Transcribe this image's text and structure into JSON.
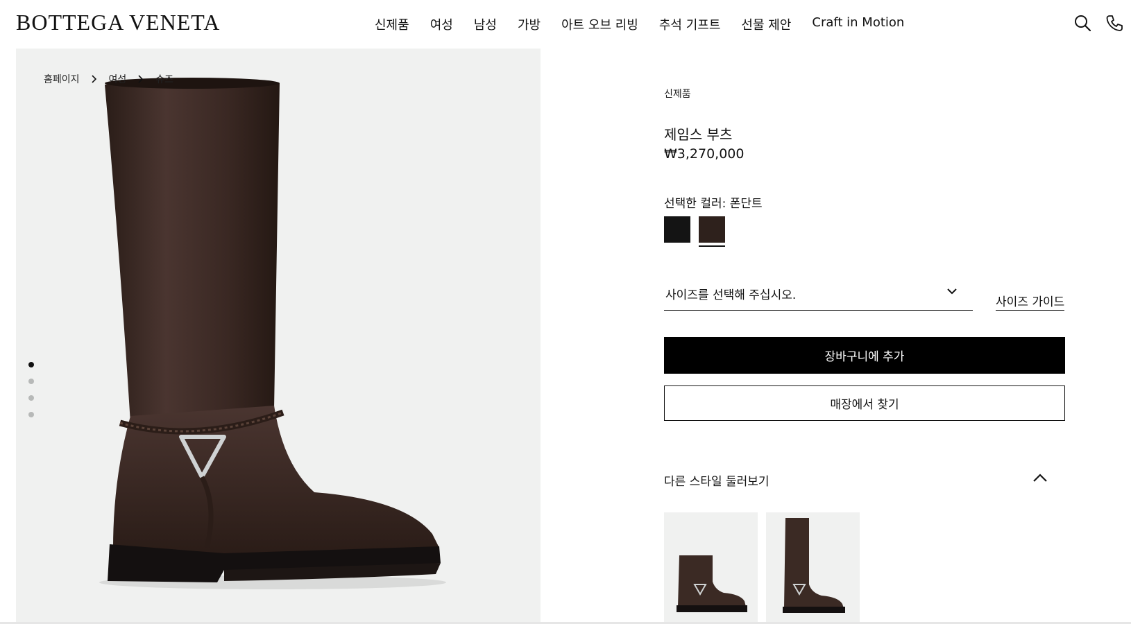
{
  "header": {
    "logo": "BOTTEGA VENETA",
    "nav": [
      "신제품",
      "여성",
      "남성",
      "가방",
      "아트 오브 리빙",
      "추석 기프트",
      "선물 제안",
      "Craft in Motion"
    ],
    "icons": [
      "search-icon",
      "phone-icon"
    ]
  },
  "breadcrumb": [
    "홈페이지",
    "여성",
    "슈즈"
  ],
  "gallery": {
    "slide_count": 4,
    "active_slide": 1
  },
  "product": {
    "tag": "신제품",
    "name": "제임스 부츠",
    "price": "₩3,270,000",
    "color_label": "선택한 컬러: 폰단트",
    "colors": [
      "#141414",
      "#2e211c"
    ],
    "size_placeholder": "사이즈를 선택해 주십시오.",
    "size_guide": "사이즈 가이드",
    "add_to_cart": "장바구니에 추가",
    "find_in_store": "매장에서 찾기"
  },
  "more_styles": {
    "title": "다른 스타일 둘러보기"
  }
}
